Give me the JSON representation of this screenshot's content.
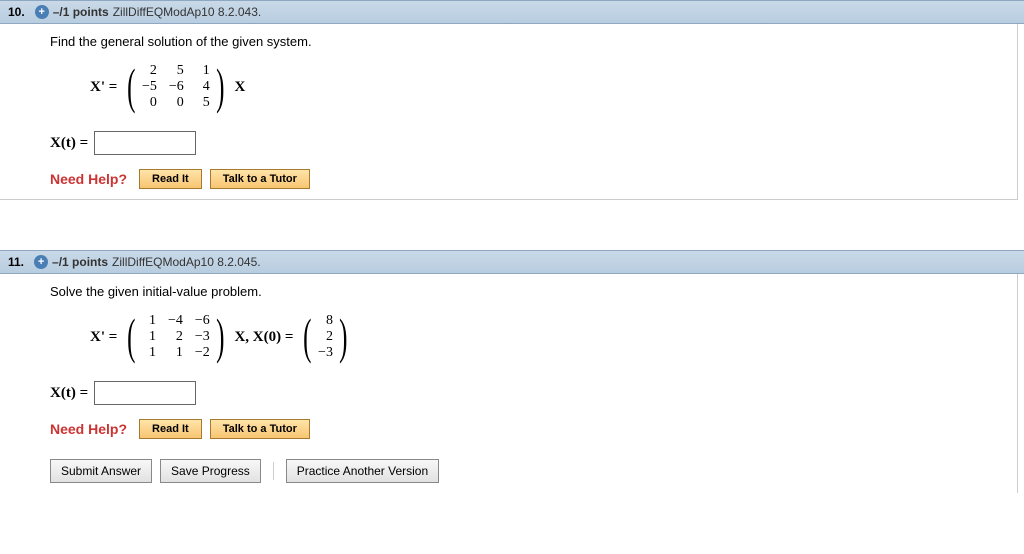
{
  "questions": [
    {
      "number": "10.",
      "points": "–/1 points",
      "source": "ZillDiffEQModAp10 8.2.043.",
      "prompt": "Find the general solution of the given system.",
      "lhs": "X' =",
      "matrix": [
        [
          "2",
          "5",
          "1"
        ],
        [
          "−5",
          "−6",
          "4"
        ],
        [
          "0",
          "0",
          "5"
        ]
      ],
      "rhs_post": "X",
      "answer_label": "X(t) =",
      "need_help": "Need Help?",
      "read_it": "Read It",
      "tutor": "Talk to a Tutor"
    },
    {
      "number": "11.",
      "points": "–/1 points",
      "source": "ZillDiffEQModAp10 8.2.045.",
      "prompt": "Solve the given initial-value problem.",
      "lhs": "X' =",
      "matrix": [
        [
          "1",
          "−4",
          "−6"
        ],
        [
          "1",
          "2",
          "−3"
        ],
        [
          "1",
          "1",
          "−2"
        ]
      ],
      "mid": "X,   X(0) =",
      "vector": [
        "8",
        "2",
        "−3"
      ],
      "answer_label": "X(t) =",
      "need_help": "Need Help?",
      "read_it": "Read It",
      "tutor": "Talk to a Tutor"
    }
  ],
  "actions": {
    "submit": "Submit Answer",
    "save": "Save Progress",
    "practice": "Practice Another Version"
  }
}
